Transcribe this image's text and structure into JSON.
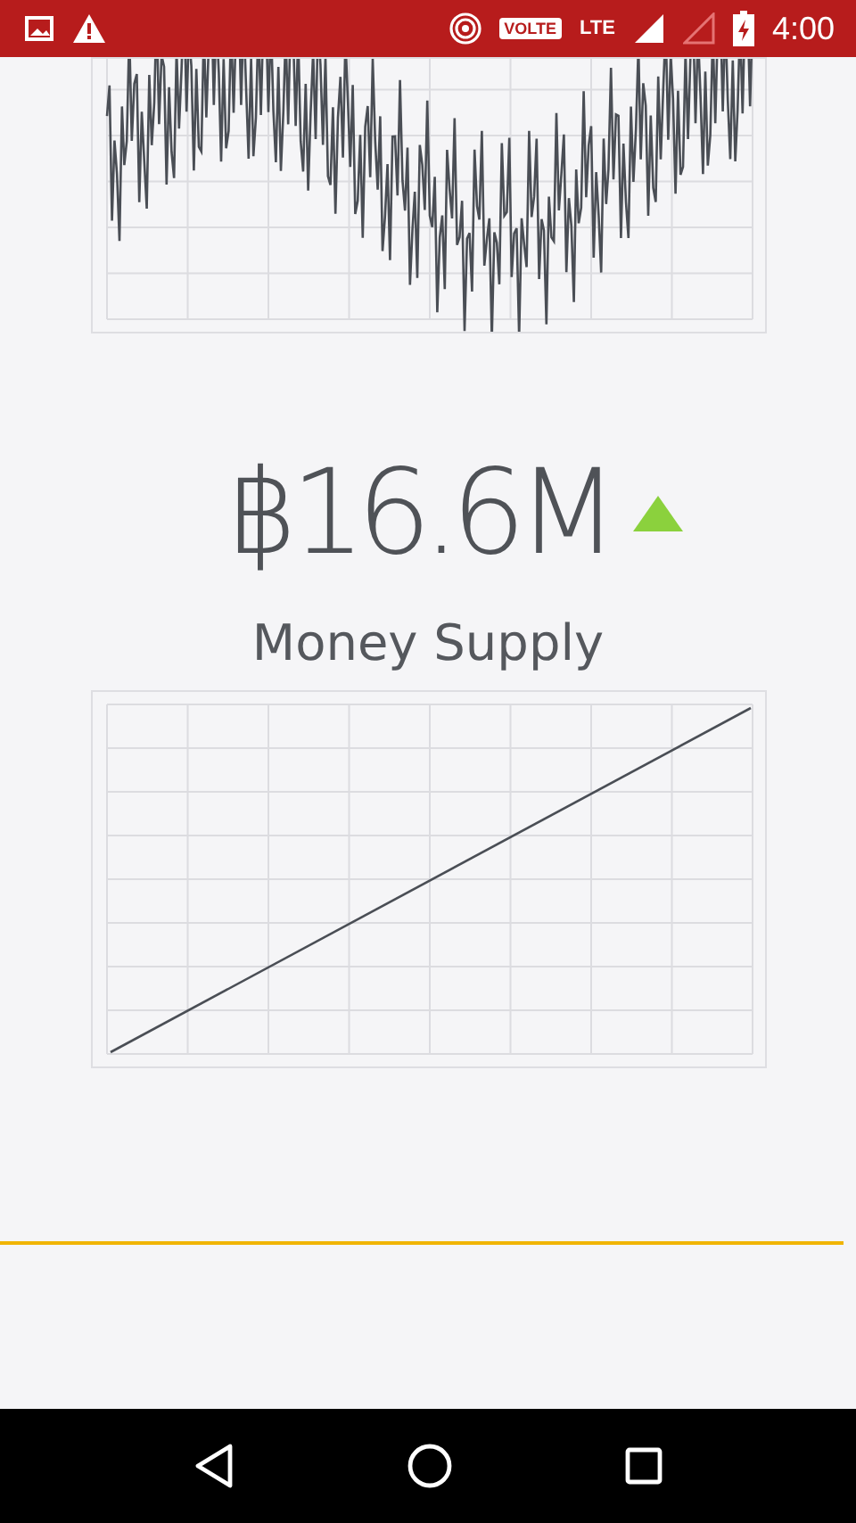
{
  "status_bar": {
    "network_badge": "VOLTE",
    "network_type": "LTE",
    "time": "4:00"
  },
  "metric": {
    "value": "฿16.6M",
    "rising": true,
    "label": "Money Supply"
  }
}
